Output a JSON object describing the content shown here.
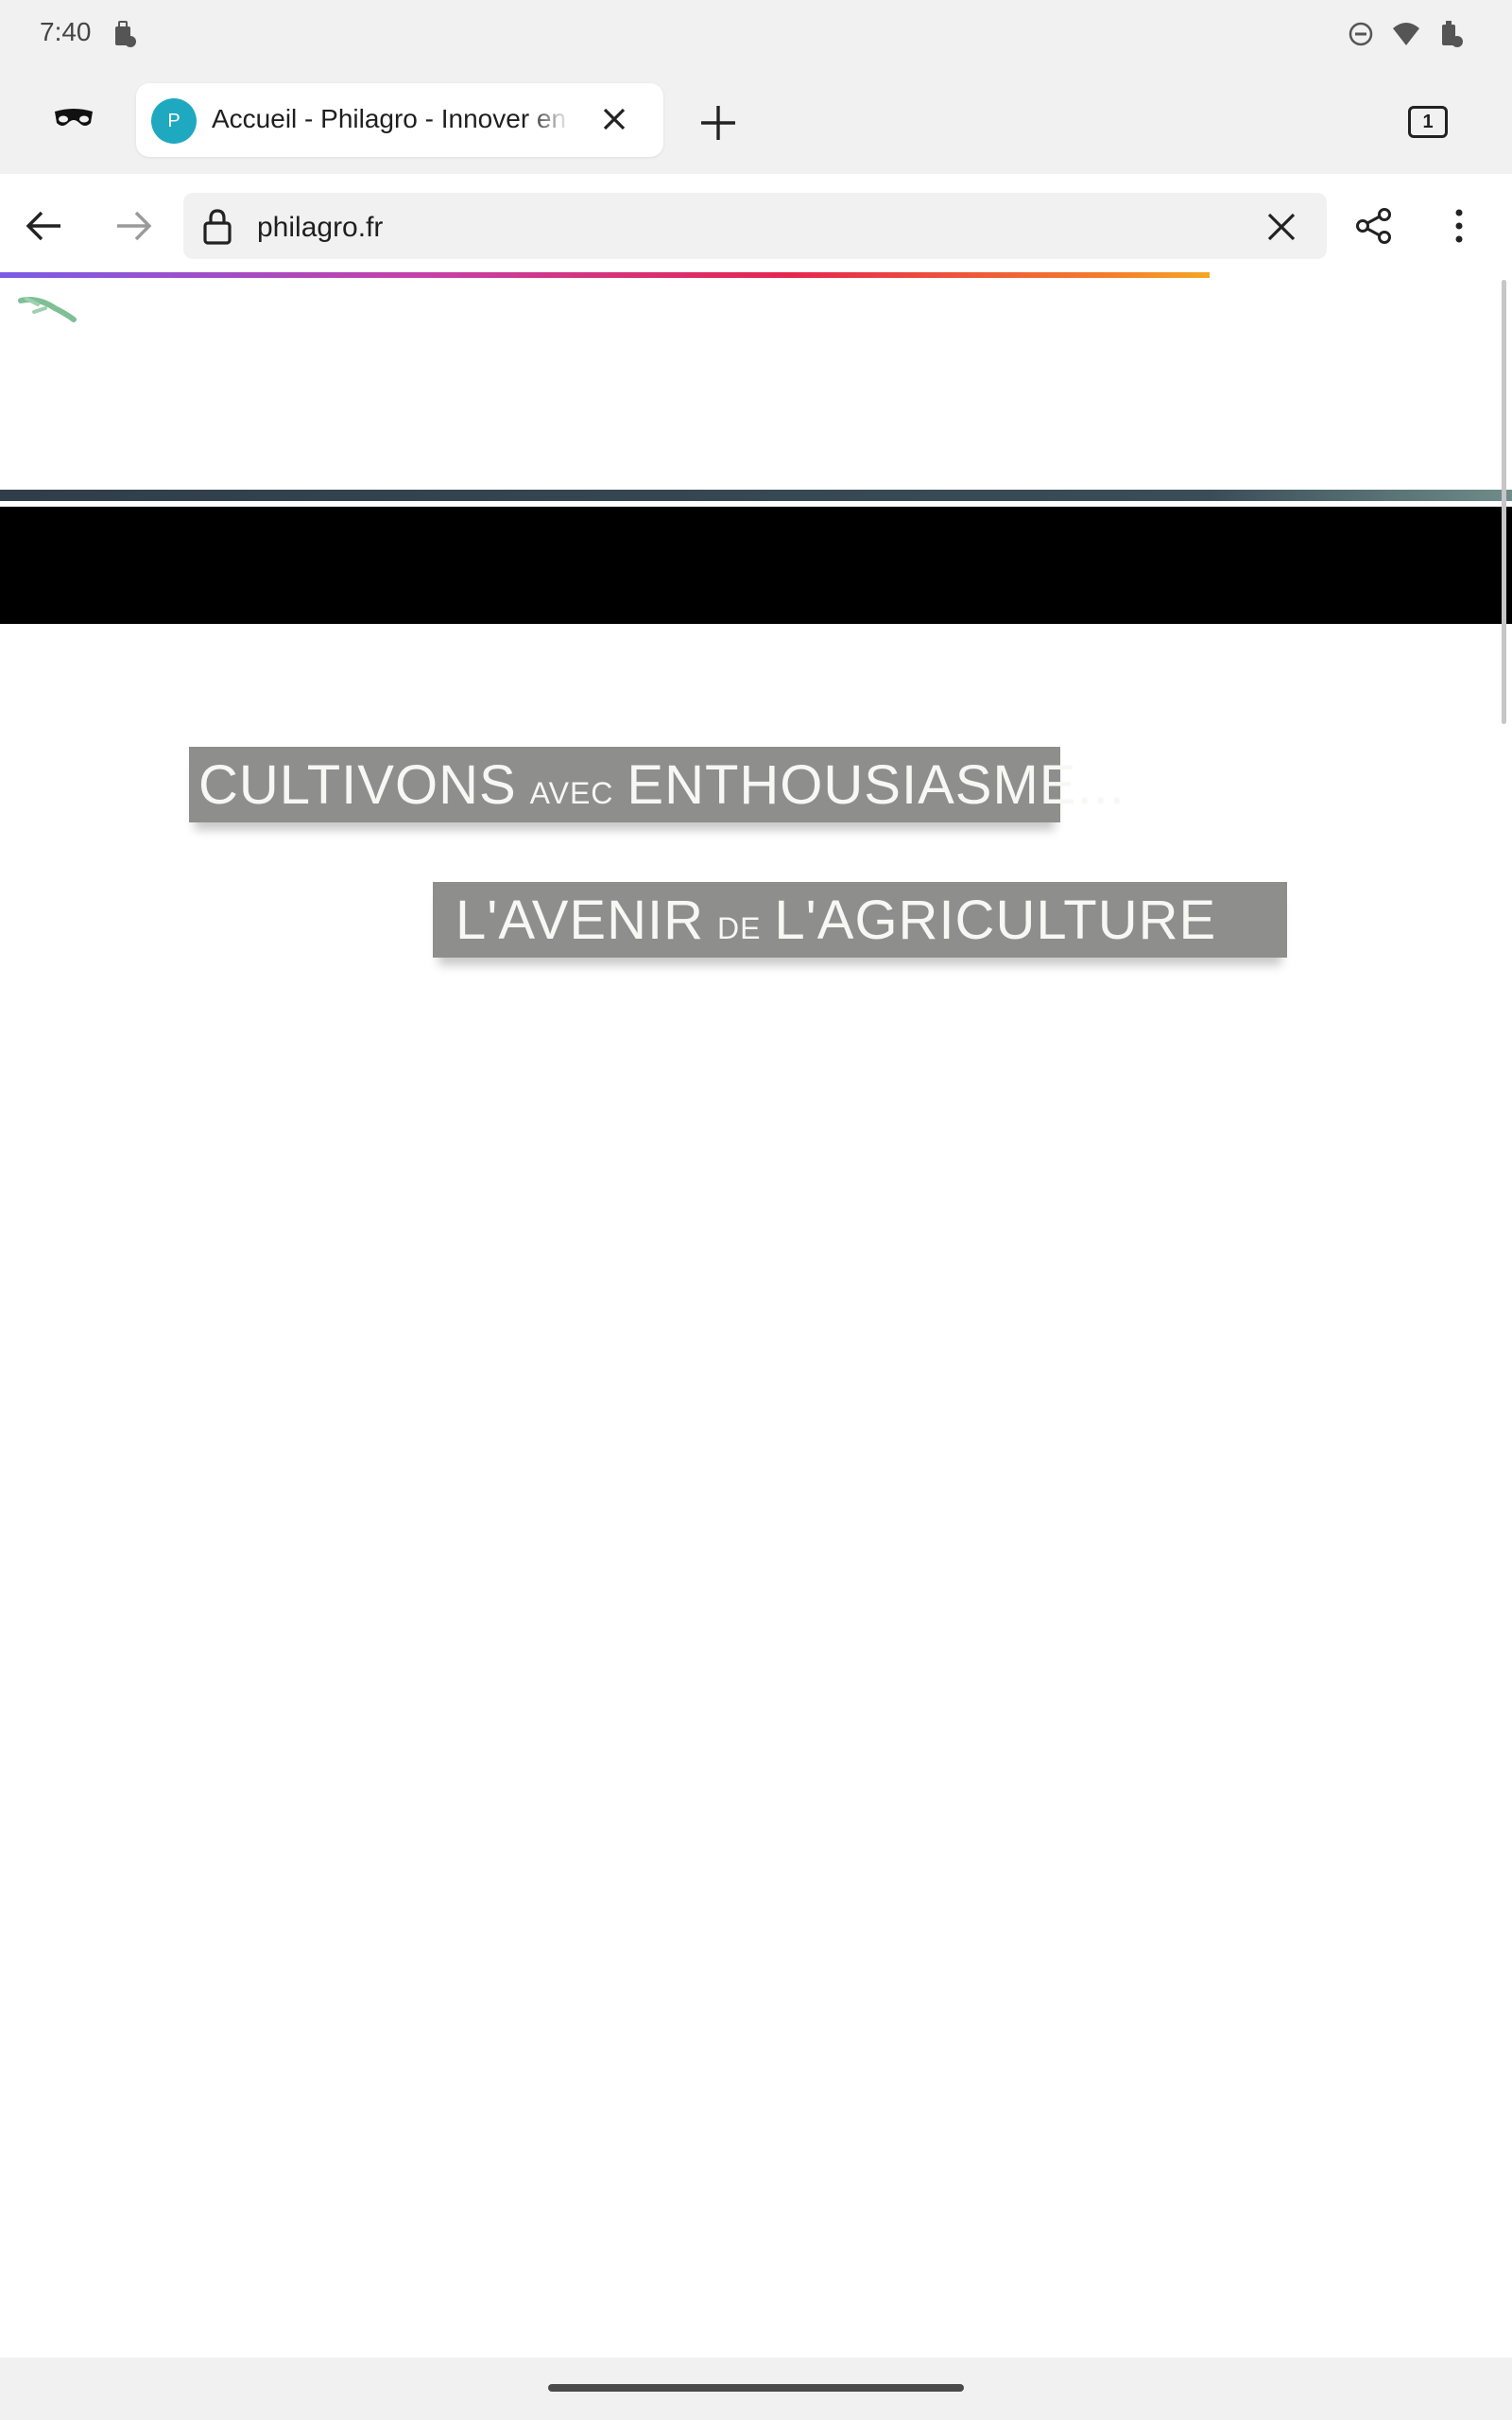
{
  "status_bar": {
    "time": "7:40",
    "icons": [
      "work-profile-icon",
      "do-not-disturb-icon",
      "wifi-icon",
      "work-battery-icon"
    ]
  },
  "tab_strip": {
    "incognito_icon": "incognito-mask-icon",
    "active_tab": {
      "favicon_letter": "P",
      "title": "Accueil - Philagro - Innover en",
      "favicon_color": "#1fa9c0"
    },
    "tab_count": "1"
  },
  "toolbar": {
    "url": "philagro.fr"
  },
  "page": {
    "banner_line1": {
      "big1": "CULTIVONS",
      "small": "AVEC",
      "big2": "ENTHOUSIASME..."
    },
    "banner_line2": {
      "big1": "L'AVENIR",
      "small": "DE",
      "big2": "L'AGRICULTURE"
    },
    "banner_color": "#8e8e8c"
  }
}
